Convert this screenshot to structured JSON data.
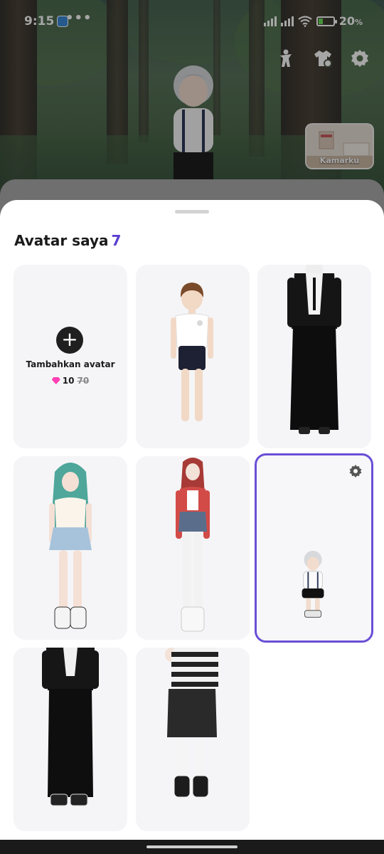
{
  "status_bar": {
    "time": "9:15",
    "dots": "•••",
    "battery": "20"
  },
  "room_button": {
    "label": "Kamarku"
  },
  "sheet": {
    "title": "Avatar saya",
    "count": "7"
  },
  "add_avatar": {
    "label": "Tambahkan avatar",
    "price": "10",
    "old_price": "70"
  },
  "colors": {
    "accent": "#6a4fd6",
    "count": "#5b3fd1",
    "gem": "#ff3fb4",
    "card_bg": "#f5f5f7"
  },
  "icons": [
    "pose-icon",
    "wardrobe-icon",
    "settings-icon",
    "add-icon",
    "gem-icon",
    "gear-icon"
  ]
}
